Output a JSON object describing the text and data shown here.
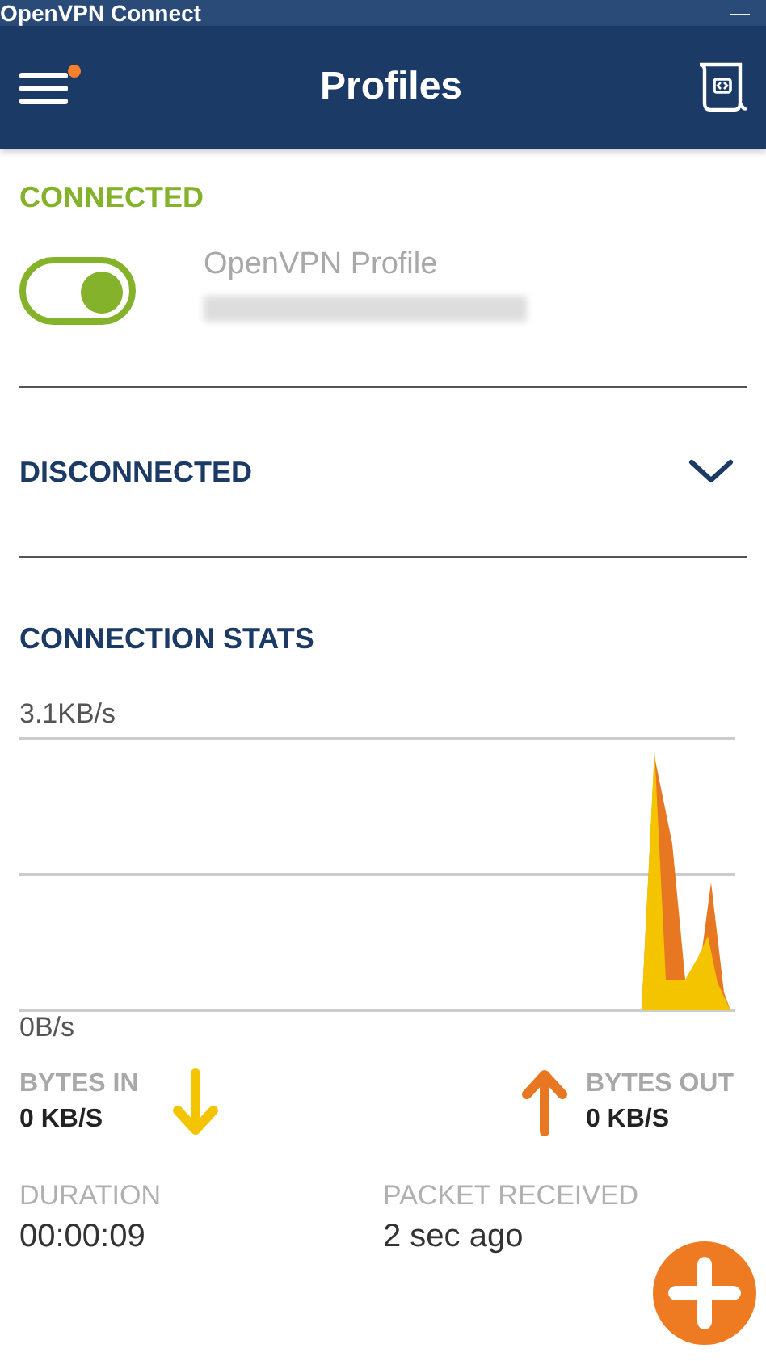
{
  "window": {
    "title": "OpenVPN Connect",
    "minimize": "—"
  },
  "header": {
    "title": "Profiles",
    "menu_badge": true
  },
  "connected_section": {
    "heading": "CONNECTED",
    "profile": {
      "name": "OpenVPN Profile",
      "on": true
    }
  },
  "disconnected_section": {
    "heading": "DISCONNECTED",
    "expanded": false
  },
  "stats": {
    "heading": "CONNECTION STATS",
    "graph": {
      "scale_max": "3.1KB/s",
      "scale_min": "0B/s"
    },
    "bytes_in": {
      "label": "BYTES IN",
      "value": "0 KB/S"
    },
    "bytes_out": {
      "label": "BYTES OUT",
      "value": "0 KB/S"
    },
    "duration": {
      "label": "DURATION",
      "value": "00:00:09"
    },
    "packet": {
      "label": "PACKET RECEIVED",
      "value": "2 sec ago"
    }
  }
}
